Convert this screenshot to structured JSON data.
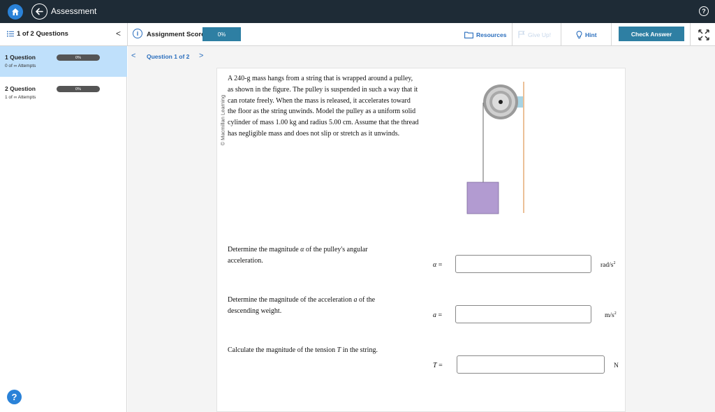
{
  "header": {
    "title": "Assessment",
    "help_glyph": "?"
  },
  "toolbar": {
    "question_count": "1 of 2 Questions",
    "collapse_glyph": "<",
    "score_label": "Assignment Score:",
    "score_value": "0%",
    "resources_label": "Resources",
    "giveup_label": "Give Up!",
    "hint_label": "Hint",
    "check_label": "Check Answer"
  },
  "sidebar": {
    "items": [
      {
        "title": "1 Question",
        "attempts": "0 of ∞ Attempts",
        "score": "0%",
        "active": true
      },
      {
        "title": "2 Question",
        "attempts": "1 of ∞ Attempts",
        "score": "0%",
        "active": false
      }
    ],
    "help_glyph": "?"
  },
  "question": {
    "nav_label": "Question 1 of 2",
    "prev_glyph": "<",
    "next_glyph": ">",
    "credit": "© Macmillan Learning",
    "problem_text": "A 240-g mass hangs from a string that is wrapped around a pulley, as shown in the figure. The pulley is suspended in such a way that it can rotate freely. When the mass is released, it accelerates toward the floor as the string unwinds. Model the pulley as a uniform solid cylinder of mass 1.00 kg and radius 5.00 cm. Assume that the thread has negligible mass and does not slip or stretch as it unwinds.",
    "parts": [
      {
        "prompt_pre": "Determine the magnitude ",
        "prompt_var": "α",
        "prompt_post": " of the pulley's angular acceleration.",
        "var_symbol": "α",
        "var_eq": " =",
        "unit_base": "rad/s",
        "unit_exp": "2",
        "value": ""
      },
      {
        "prompt_pre": "Determine the magnitude of the acceleration ",
        "prompt_var": "a",
        "prompt_post": " of the descending weight.",
        "var_symbol": "a",
        "var_eq": " =",
        "unit_base": "m/s",
        "unit_exp": "2",
        "value": ""
      },
      {
        "prompt_pre": "Calculate the magnitude of the tension ",
        "prompt_var": "T",
        "prompt_post": " in the string.",
        "var_symbol": "T",
        "var_eq": " =",
        "unit_base": "N",
        "unit_exp": "",
        "value": ""
      }
    ]
  },
  "colors": {
    "topbar": "#1e2b36",
    "accent": "#2a6ebd",
    "button": "#2e7fa3",
    "active_item": "#bfe0fb",
    "mass_block": "#b29bd1",
    "pulley_outer": "#9a9a9a",
    "support_rod": "#e6b07f"
  },
  "icons": {
    "home": "home-icon",
    "back": "back-arrow-icon",
    "list": "list-icon",
    "info": "info-icon",
    "folder": "folder-icon",
    "flag": "flag-icon",
    "bulb": "lightbulb-icon",
    "expand": "expand-icon"
  }
}
